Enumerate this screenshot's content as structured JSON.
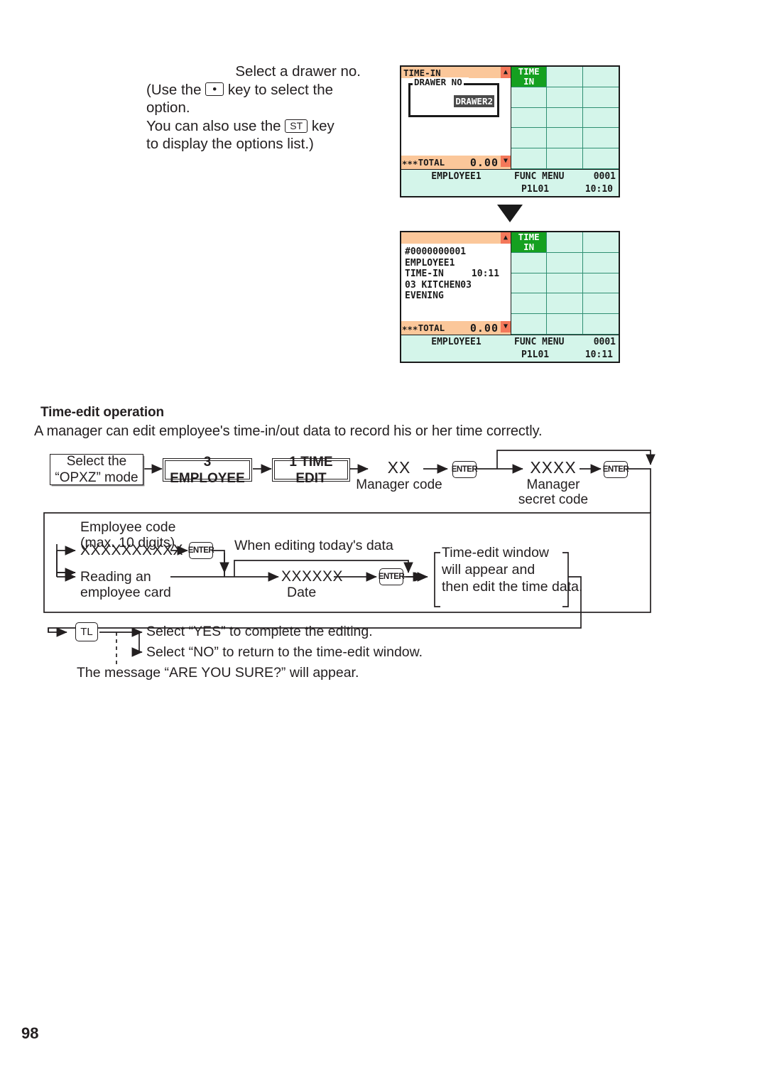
{
  "intro": {
    "line1": "Select a drawer no.",
    "line2_pre": "(Use the ",
    "line2_key": "•",
    "line2_post": " key to select the",
    "line3": "option.",
    "line4_pre": "You can also use the ",
    "line4_key": "ST",
    "line4_post": " key",
    "line5": "to display the options list.)"
  },
  "lcd1": {
    "title": "TIME-IN",
    "scroll_up": "▲",
    "scroll_down": "▼",
    "drawer_label": "DRAWER NO.",
    "drawer_value": "DRAWER2",
    "total_label": "∗∗∗TOTAL",
    "total_amount": "0.00",
    "keys": [
      "TIME\nIN",
      "",
      "",
      "",
      "",
      "",
      "",
      "",
      "",
      "",
      "",
      "",
      "",
      "",
      ""
    ],
    "status": {
      "employee": "EMPLOYEE1",
      "menu": "FUNC MENU",
      "counter": "0001",
      "position": "P1L01",
      "time": "10:10"
    }
  },
  "lcd2": {
    "title": "",
    "scroll_up": "▲",
    "scroll_down": "▼",
    "lines": [
      "#0000000001",
      "EMPLOYEE1",
      "TIME-IN     10:11",
      "03 KITCHEN03",
      "EVENING"
    ],
    "total_label": "∗∗∗TOTAL",
    "total_amount": "0.00",
    "keys": [
      "TIME\nIN",
      "",
      "",
      "",
      "",
      "",
      "",
      "",
      "",
      "",
      "",
      "",
      "",
      "",
      ""
    ],
    "status": {
      "employee": "EMPLOYEE1",
      "menu": "FUNC MENU",
      "counter": "0001",
      "position": "P1L01",
      "time": "10:11"
    }
  },
  "section": {
    "heading": "Time-edit operation",
    "description": "A manager can edit employee's time-in/out data to record his or her time correctly."
  },
  "flow": {
    "mode_box_line1": "Select the",
    "mode_box_line2": "“OPXZ” mode",
    "employee_box": "3 EMPLOYEE",
    "time_edit_box": "1 TIME EDIT",
    "manager_code_value": "XX",
    "manager_code_label": "Manager code",
    "enter1": "ENTER",
    "secret_code_value": "XXXX",
    "secret_code_label_l1": "Manager",
    "secret_code_label_l2": "secret code",
    "enter2": "ENTER",
    "employee_code_l1": "Employee code",
    "employee_code_l2": "(max. 10 digits)",
    "employee_code_value": "XXXXXXXXXX",
    "enter3": "ENTER",
    "reading_card_l1": "Reading an",
    "reading_card_l2": "employee card",
    "today_note": "When editing today's data",
    "date_value": "XXXXXX",
    "date_label": "Date",
    "enter4": "ENTER",
    "window_l1": "Time-edit window",
    "window_l2": "will appear and",
    "window_l3": "then edit the time data.",
    "tl_key": "TL",
    "yes_text": "Select “YES” to complete the editing.",
    "no_text": "Select “NO” to return to the time-edit window.",
    "sure_text": "The message “ARE YOU SURE?” will appear."
  },
  "page": {
    "number": "98"
  },
  "colors": {
    "lcd_header": "#fbc79a",
    "lcd_key": "#d4f5ea",
    "lcd_key_active": "#15a020",
    "scroll_indicator": "#f4785a",
    "text": "#231f20"
  }
}
